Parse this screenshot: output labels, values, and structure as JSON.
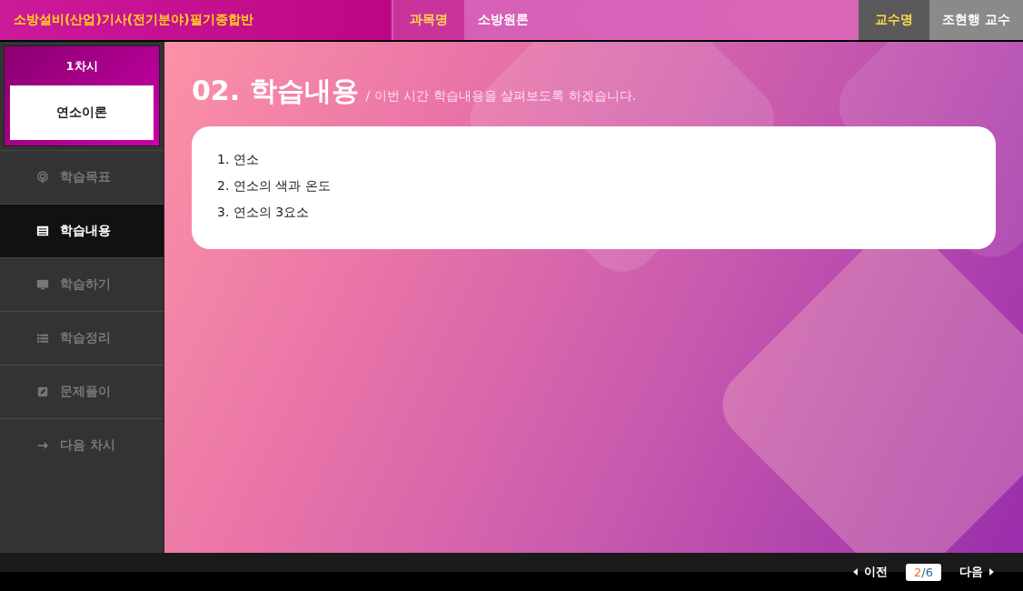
{
  "header": {
    "course_title": "소방설비(산업)기사(전기분야)필기종합반",
    "subject_label": "과목명",
    "subject": "소방원론",
    "professor_label": "교수명",
    "professor": "조현행 교수"
  },
  "sidebar": {
    "session": "1차시",
    "lesson": "연소이론",
    "items": [
      {
        "label": "학습목표",
        "kind": "target",
        "selected": false
      },
      {
        "label": "학습내용",
        "kind": "list",
        "selected": true
      },
      {
        "label": "학습하기",
        "kind": "monitor",
        "selected": false
      },
      {
        "label": "학습정리",
        "kind": "bullets",
        "selected": false
      },
      {
        "label": "문제풀이",
        "kind": "edit",
        "selected": false
      },
      {
        "label": "다음 차시",
        "kind": "arrow",
        "selected": false
      }
    ]
  },
  "content": {
    "heading": "02. 학습내용",
    "subheading": "/ 이번 시간 학습내용을 살펴보도록 하겠습니다.",
    "items": [
      "1. 연소",
      "2. 연소의 색과 온도",
      "3. 연소의 3요소"
    ]
  },
  "footer": {
    "prev": "이전",
    "current": "2",
    "separator": "/",
    "total": "6",
    "next": "다음"
  }
}
